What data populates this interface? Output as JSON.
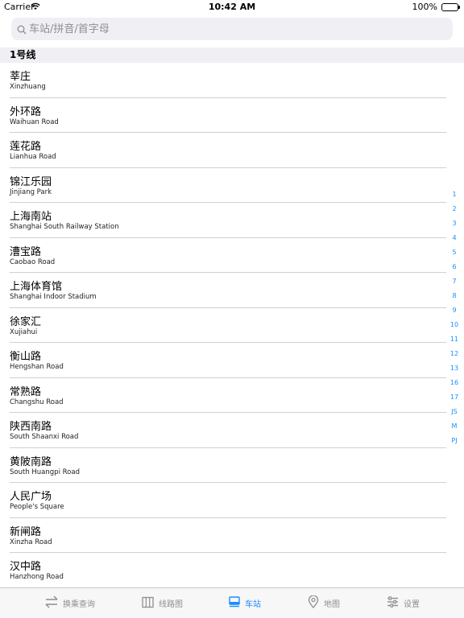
{
  "status_bar": {
    "carrier": "Carrier",
    "time": "10:42 AM",
    "battery": "100%"
  },
  "search": {
    "placeholder": "车站/拼音/首字母",
    "value": ""
  },
  "section": {
    "title": "1号线"
  },
  "stations": [
    {
      "zh": "莘庄",
      "en": "Xinzhuang"
    },
    {
      "zh": "外环路",
      "en": "Waihuan Road"
    },
    {
      "zh": "莲花路",
      "en": "Lianhua Road"
    },
    {
      "zh": "锦江乐园",
      "en": "Jinjiang Park"
    },
    {
      "zh": "上海南站",
      "en": "Shanghai South Railway Station"
    },
    {
      "zh": "漕宝路",
      "en": "Caobao Road"
    },
    {
      "zh": "上海体育馆",
      "en": "Shanghai Indoor Stadium"
    },
    {
      "zh": "徐家汇",
      "en": "Xujiahui"
    },
    {
      "zh": "衡山路",
      "en": "Hengshan Road"
    },
    {
      "zh": "常熟路",
      "en": "Changshu Road"
    },
    {
      "zh": "陕西南路",
      "en": "South Shaanxi Road"
    },
    {
      "zh": "黄陂南路",
      "en": "South Huangpi Road"
    },
    {
      "zh": "人民广场",
      "en": "People's Square"
    },
    {
      "zh": "新闸路",
      "en": "Xinzha Road"
    },
    {
      "zh": "汉中路",
      "en": "Hanzhong Road"
    }
  ],
  "index": [
    "1",
    "2",
    "3",
    "4",
    "5",
    "6",
    "7",
    "8",
    "9",
    "10",
    "11",
    "12",
    "13",
    "16",
    "17",
    "JS",
    "M",
    "PJ"
  ],
  "tabs": [
    {
      "label": "换乘查询",
      "icon": "transfer-icon",
      "active": false
    },
    {
      "label": "线路图",
      "icon": "map-book-icon",
      "active": false
    },
    {
      "label": "车站",
      "icon": "station-icon",
      "active": true
    },
    {
      "label": "地图",
      "icon": "location-pin-icon",
      "active": false
    },
    {
      "label": "设置",
      "icon": "settings-icon",
      "active": false
    }
  ],
  "colors": {
    "accent": "#1a8cff",
    "inactive": "#8e8e93",
    "section_bg": "#efeff4"
  }
}
